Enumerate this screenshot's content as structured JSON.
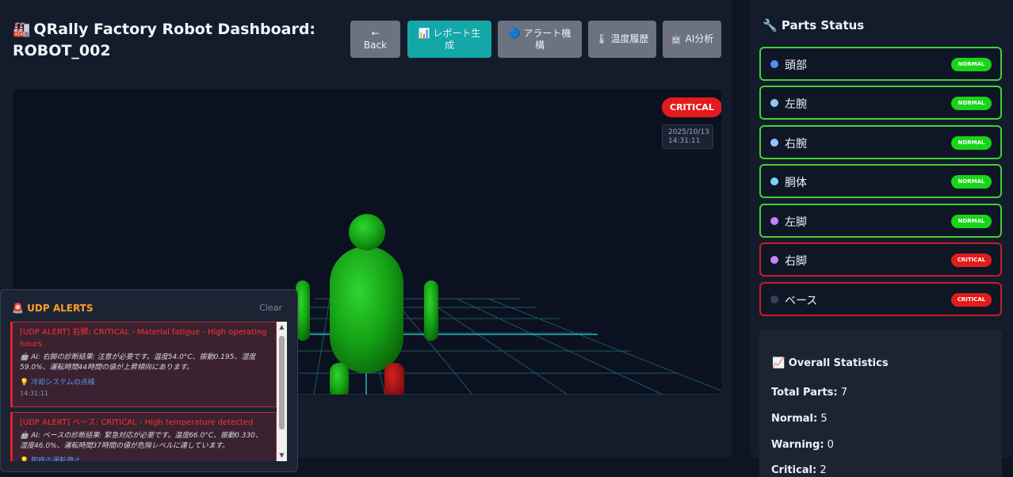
{
  "header": {
    "title_icon": "🏭",
    "title": "QRally Factory Robot Dashboard: ROBOT_002"
  },
  "toolbar": {
    "back": {
      "icon": "←",
      "label": "Back"
    },
    "report": {
      "icon": "📊",
      "label": "レポート生成"
    },
    "alert": {
      "icon": "🔵",
      "label": "アラート機構"
    },
    "temp": {
      "icon": "🌡",
      "label": "温度履歴"
    },
    "ai": {
      "icon": "🤖",
      "label": "AI分析"
    }
  },
  "viewport": {
    "status": "CRITICAL",
    "timestamp_date": "2025/10/13",
    "timestamp_time": "14:31:11"
  },
  "alerts_panel": {
    "icon": "🚨",
    "title": "UDP ALERTS",
    "clear": "Clear",
    "alerts": [
      {
        "title": "[UDP ALERT] 右脚: CRITICAL - Material fatigue - High operating hours",
        "ai": "🤖 AI: 右脚の診断結果: 注意が必要です。温度54.0°C、振動0.195、湿度59.0%、運転時間44時間の値が上昇傾向にあります。",
        "hint": "💡 冷却システムの点検",
        "time": "14:31:11"
      },
      {
        "title": "[UDP ALERT] ベース: CRITICAL - High temperature detected",
        "ai": "🤖 AI: ベースの診断結果: 緊急対応が必要です。温度66.0°C、振動0.330、湿度46.0%、運転時間37時間の値が危険レベルに達しています。",
        "hint": "💡 即座の運転停止"
      }
    ]
  },
  "parts_panel": {
    "icon": "🔧",
    "title": "Parts Status",
    "parts": [
      {
        "name": "頭部",
        "status": "NORMAL",
        "dot_color": "#4f8ff7"
      },
      {
        "name": "左腕",
        "status": "NORMAL",
        "dot_color": "#93c5fd"
      },
      {
        "name": "右腕",
        "status": "NORMAL",
        "dot_color": "#93c5fd"
      },
      {
        "name": "胴体",
        "status": "NORMAL",
        "dot_color": "#7dd3fc"
      },
      {
        "name": "左脚",
        "status": "NORMAL",
        "dot_color": "#c084fc"
      },
      {
        "name": "右脚",
        "status": "CRITICAL",
        "dot_color": "#c084fc"
      },
      {
        "name": "ベース",
        "status": "CRITICAL",
        "dot_color": "#334155"
      }
    ]
  },
  "stats_panel": {
    "icon": "📈",
    "title": "Overall Statistics",
    "total_label": "Total Parts:",
    "total": "7",
    "normal_label": "Normal:",
    "normal": "5",
    "warning_label": "Warning:",
    "warning": "0",
    "critical_label": "Critical:",
    "critical": "2"
  },
  "colors": {
    "normal": "#19d419",
    "critical": "#e21c1c",
    "teal_button": "#14a7a7",
    "robot_green": "#1aa81a",
    "robot_red": "#b51414"
  }
}
